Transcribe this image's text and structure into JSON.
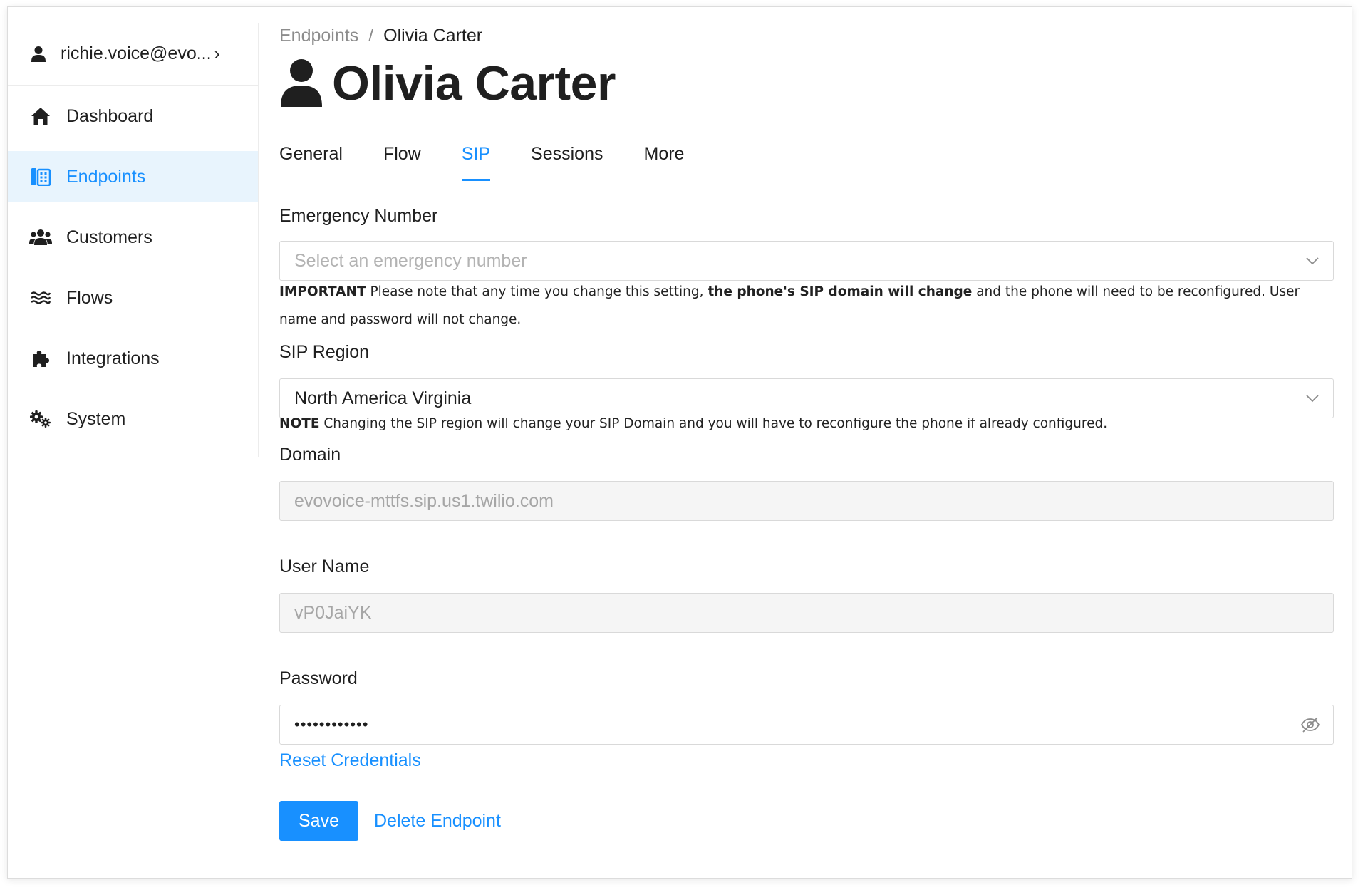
{
  "sidebar": {
    "user": {
      "label": "richie.voice@evo...",
      "icon": "user-icon",
      "chevron": "›"
    },
    "items": [
      {
        "label": "Dashboard",
        "icon": "home-icon"
      },
      {
        "label": "Endpoints",
        "icon": "phone-book-icon",
        "active": true
      },
      {
        "label": "Customers",
        "icon": "users-icon"
      },
      {
        "label": "Flows",
        "icon": "waves-icon"
      },
      {
        "label": "Integrations",
        "icon": "puzzle-icon"
      },
      {
        "label": "System",
        "icon": "gears-icon"
      }
    ]
  },
  "breadcrumb": {
    "parent": "Endpoints",
    "separator": "/",
    "current": "Olivia Carter"
  },
  "page": {
    "title": "Olivia Carter",
    "icon": "user-icon"
  },
  "tabs": [
    {
      "label": "General"
    },
    {
      "label": "Flow"
    },
    {
      "label": "SIP",
      "active": true
    },
    {
      "label": "Sessions"
    },
    {
      "label": "More"
    }
  ],
  "form": {
    "emergency": {
      "label": "Emergency Number",
      "placeholder": "Select an emergency number",
      "note_strong1": "IMPORTANT",
      "note_text1": " Please note that any time you change this setting, ",
      "note_strong2": "the phone's SIP domain will change",
      "note_text2": " and the phone will need to be reconfigured. User name and password will not change."
    },
    "region": {
      "label": "SIP Region",
      "value": "North America Virginia",
      "note_strong": "NOTE",
      "note_text": " Changing the SIP region will change your SIP Domain and you will have to reconfigure the phone if already configured."
    },
    "domain": {
      "label": "Domain",
      "value": "evovoice-mttfs.sip.us1.twilio.com"
    },
    "username": {
      "label": "User Name",
      "value": "vP0JaiYK"
    },
    "password": {
      "label": "Password",
      "value": "••••••••••••"
    },
    "reset_label": "Reset Credentials",
    "save_label": "Save",
    "delete_label": "Delete Endpoint"
  },
  "colors": {
    "accent": "#1890ff",
    "active_bg": "#e8f4fd",
    "disabled_bg": "#f5f5f5"
  }
}
